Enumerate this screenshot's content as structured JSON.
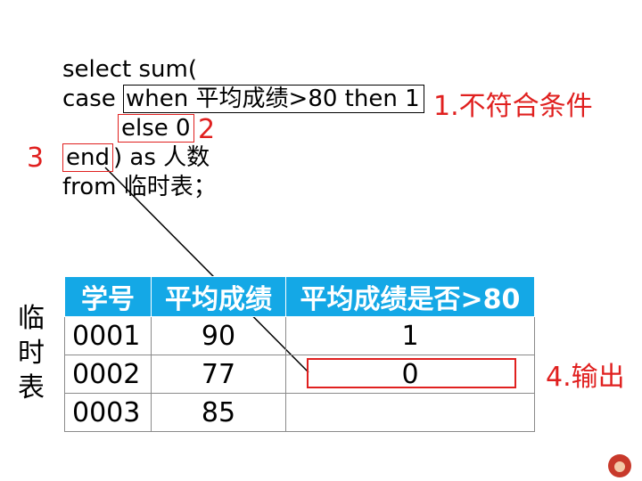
{
  "code": {
    "line1": "select sum(",
    "line2_prefix": "case ",
    "line2_boxed": "when 平均成绩>80 then 1",
    "line3_boxed": "else 0",
    "line4_boxed": "end",
    "line4_rest": ") as 人数",
    "line5": "from 临时表；"
  },
  "annotations": {
    "a1": "1.不符合条件",
    "a2": "2",
    "a3": "3",
    "a4": "4.输出"
  },
  "side_label": [
    "临",
    "时",
    "表"
  ],
  "table": {
    "headers": [
      "学号",
      "平均成绩",
      "平均成绩是否>80"
    ],
    "rows": [
      [
        "0001",
        "90",
        "1"
      ],
      [
        "0002",
        "77",
        "0"
      ],
      [
        "0003",
        "85",
        ""
      ]
    ]
  },
  "colors": {
    "header_bg": "#14a8e6",
    "annotation_red": "#e0201f"
  }
}
